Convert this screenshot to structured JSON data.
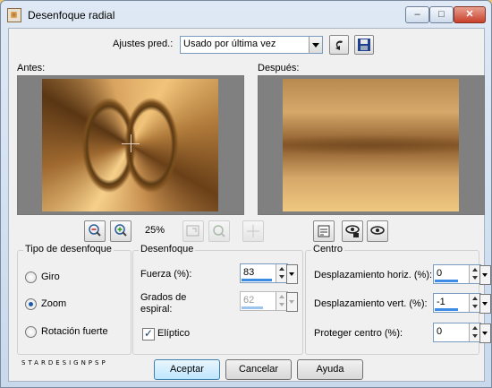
{
  "window": {
    "title": "Desenfoque radial"
  },
  "presets": {
    "label": "Ajustes pred.:",
    "value": "Usado por última vez"
  },
  "previews": {
    "before_label": "Antes:",
    "after_label": "Después:"
  },
  "zoom": {
    "level": "25%"
  },
  "blur_type": {
    "title": "Tipo de desenfoque",
    "options": [
      {
        "label": "Giro",
        "selected": false
      },
      {
        "label": "Zoom",
        "selected": true
      },
      {
        "label": "Rotación fuerte",
        "selected": false
      }
    ]
  },
  "blur": {
    "title": "Desenfoque",
    "strength_label": "Fuerza (%):",
    "strength_value": "83",
    "spiral_label_line1": "Grados de",
    "spiral_label_line2": "espiral:",
    "spiral_value": "62",
    "elliptic_label": "Elíptico",
    "elliptic_checked": true
  },
  "center": {
    "title": "Centro",
    "horiz_label": "Desplazamiento horiz. (%):",
    "horiz_value": "0",
    "vert_label": "Desplazamiento vert. (%):",
    "vert_value": "-1",
    "protect_label": "Proteger centro (%):",
    "protect_value": "0"
  },
  "footer": {
    "watermark": "STARDESIGNPSP",
    "ok_label": "Aceptar",
    "cancel_label": "Cancelar",
    "help_label": "Ayuda"
  }
}
